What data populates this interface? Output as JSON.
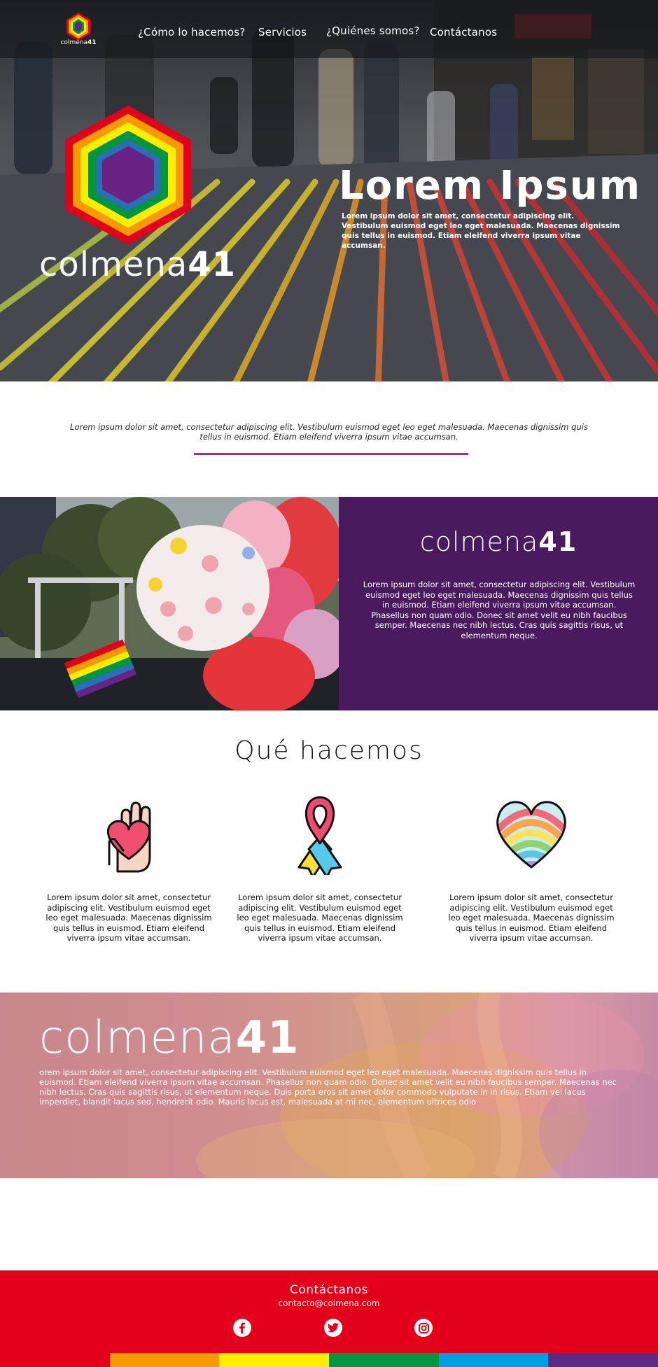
{
  "nav": {
    "logo_text": "colmena",
    "logo_num": "41",
    "items": [
      {
        "label": "¿Cómo lo hacemos?"
      },
      {
        "label": "Servicios"
      },
      {
        "label": "¿Quiénes somos?"
      },
      {
        "label": "Contáctanos"
      }
    ]
  },
  "hero": {
    "brand_text": "colmena",
    "brand_num": "41",
    "title": "Lorem Ipsum",
    "body": "Lorem ipsum dolor sit amet, consectetur adipiscing elit. Vestibulum euismod eget leo eget malesuada. Maecenas dignissim quis tellus in euismod. Etiam eleifend viverra ipsum vitae accumsan."
  },
  "intro": {
    "text": "Lorem ipsum dolor sit amet, consectetur adipiscing elit. Vestibulum euismod eget leo eget malesuada. Maecenas dignissim quis tellus in euismod. Etiam eleifend viverra ipsum vitae accumsan."
  },
  "about": {
    "brand_text": "colmena",
    "brand_num": "41",
    "text": "Lorem ipsum dolor sit amet, consectetur adipiscing elit. Vestibulum euismod eget leo eget malesuada. Maecenas dignissim quis tellus in euismod. Etiam eleifend viverra ipsum vitae accumsan. Phasellus non quam odio. Donec sit amet velit eu nibh faucibus semper. Maecenas nec nibh lectus. Cras quis sagittis risus, ut elementum neque."
  },
  "what": {
    "title": "Qué hacemos",
    "services": [
      {
        "icon": "heart-in-hand-icon",
        "text": "Lorem ipsum dolor sit amet, consectetur adipiscing elit. Vestibulum euismod eget leo eget malesuada. Maecenas dignissim quis tellus in euismod. Etiam eleifend viverra ipsum vitae accumsan."
      },
      {
        "icon": "awareness-ribbon-icon",
        "text": "Lorem ipsum dolor sit amet, consectetur adipiscing elit. Vestibulum euismod eget leo eget malesuada. Maecenas dignissim quis tellus in euismod. Etiam eleifend viverra ipsum vitae accumsan."
      },
      {
        "icon": "rainbow-heart-icon",
        "text": "Lorem ipsum dolor sit amet, consectetur adipiscing elit. Vestibulum euismod eget leo eget malesuada. Maecenas dignissim quis tellus in euismod. Etiam eleifend viverra ipsum vitae accumsan."
      }
    ]
  },
  "banner": {
    "brand_text": "colmena",
    "brand_num": "41",
    "text": "orem ipsum dolor sit amet, consectetur adipiscing elit. Vestibulum euismod eget leo eget malesuada. Maecenas dignissim quis tellus in euismod. Etiam eleifend viverra ipsum vitae accumsan. Phasellus non quam odio. Donec sit amet velit eu nibh faucibus semper. Maecenas nec nibh lectus. Cras quis sagittis risus, ut elementum neque. Duis porta eros sit amet dolor commodo vulputate in in risus. Etiam vel lacus imperdiet, blandit lacus sed, hendrerit odio. Mauris lacus est, malesuada at mi nec, elementum ultrices odio"
  },
  "footer": {
    "title": "Contáctanos",
    "email": "contacto@colmena.com",
    "social": [
      {
        "icon": "facebook-icon"
      },
      {
        "icon": "twitter-icon"
      },
      {
        "icon": "instagram-icon"
      }
    ]
  },
  "colors": {
    "accent_pink": "#d7177f",
    "purple_panel": "#4a1a5e",
    "footer_red": "#e2001b",
    "rainbow": [
      "#e2001b",
      "#f59a00",
      "#ffed00",
      "#009640",
      "#009fe3",
      "#5b2a86"
    ]
  }
}
